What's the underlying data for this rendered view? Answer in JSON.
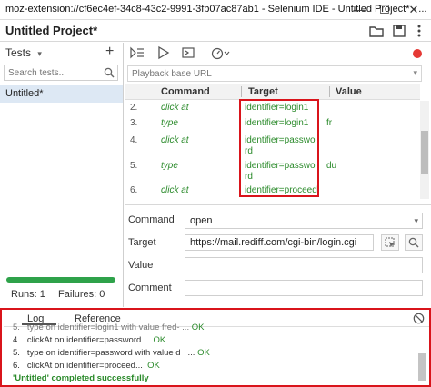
{
  "window": {
    "title": "moz-extension://cf6ec4ef-34c8-43c2-9991-3fb07ac87ab1 - Selenium IDE - Untitled Project* - ...",
    "minimize": "—",
    "maximize": "☐",
    "close": "✕"
  },
  "project": {
    "name": "Untitled Project*"
  },
  "tests": {
    "header": "Tests",
    "add": "+",
    "search_placeholder": "Search tests...",
    "items": [
      "Untitled*"
    ]
  },
  "runs": {
    "runs_label": "Runs: 1",
    "failures_label": "Failures: 0",
    "progress": 1.0
  },
  "playback": {
    "placeholder": "Playback base URL"
  },
  "table": {
    "headers": {
      "command": "Command",
      "target": "Target",
      "value": "Value"
    },
    "rows": [
      {
        "num": "2.",
        "command": "click at",
        "target": "identifier=login1",
        "value": ""
      },
      {
        "num": "3.",
        "command": "type",
        "target": "identifier=login1",
        "value": "fr"
      },
      {
        "num": "4.",
        "command": "click at",
        "target": "identifier=password",
        "value": ""
      },
      {
        "num": "5.",
        "command": "type",
        "target": "identifier=password",
        "value": "du"
      },
      {
        "num": "6.",
        "command": "click at",
        "target": "identifier=proceed",
        "value": ""
      }
    ]
  },
  "editor": {
    "command_label": "Command",
    "command_value": "open",
    "target_label": "Target",
    "target_value": "https://mail.rediff.com/cgi-bin/login.cgi",
    "value_label": "Value",
    "value_value": "",
    "comment_label": "Comment",
    "comment_value": ""
  },
  "log": {
    "tabs": [
      "Log",
      "Reference"
    ],
    "lines": [
      {
        "prefix": "5.",
        "text": "type on identifier=login1 with value fred-",
        "status": "OK"
      },
      {
        "prefix": "4.",
        "text": "clickAt on identifier=password...",
        "status": "OK"
      },
      {
        "prefix": "5.",
        "text": "type on identifier=password with value d",
        "status": "OK"
      },
      {
        "prefix": "6.",
        "text": "clickAt on identifier=proceed...",
        "status": "OK"
      }
    ],
    "success": "'Untitled' completed successfully"
  },
  "colors": {
    "accent_red": "#d9141b",
    "ok_green": "#2a8a2a",
    "progress_green": "#2ea24a",
    "record": "#e53935"
  }
}
